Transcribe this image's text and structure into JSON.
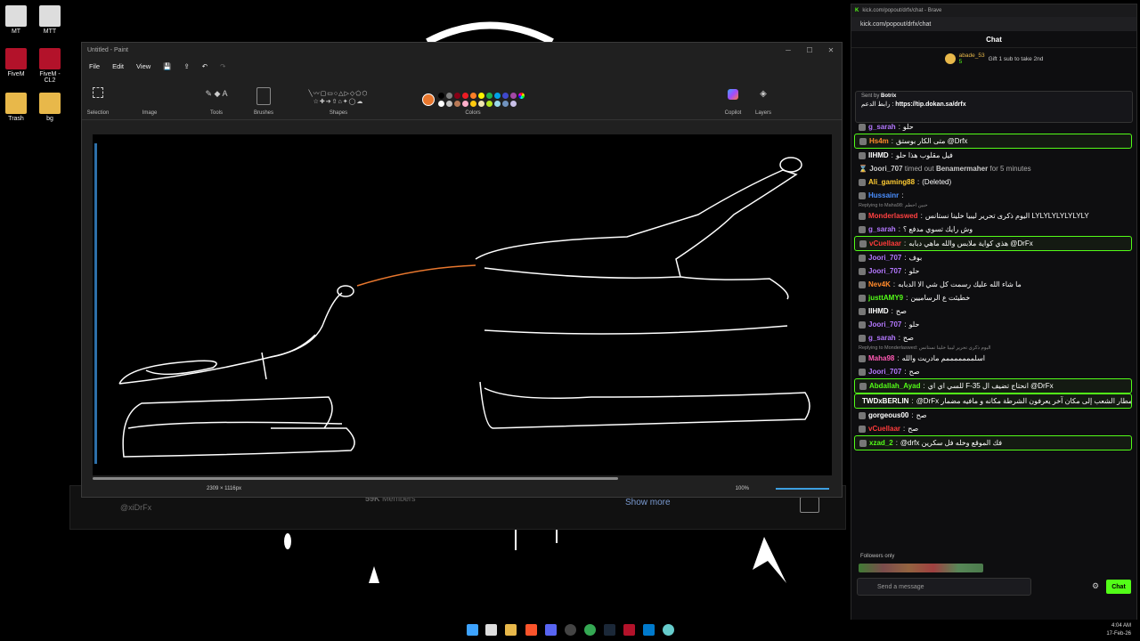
{
  "desktop": {
    "icons": [
      {
        "label": "MT"
      },
      {
        "label": "MTT"
      },
      {
        "label": "FiveM"
      },
      {
        "label": "FiveM - CL2"
      },
      {
        "label": "Trash"
      },
      {
        "label": "bg"
      }
    ]
  },
  "paint": {
    "title": "Untitled - Paint",
    "menu": [
      "File",
      "Edit",
      "View"
    ],
    "groups": [
      "Selection",
      "Image",
      "Tools",
      "Brushes",
      "Shapes",
      "Colors",
      "Copilot",
      "Layers"
    ],
    "status": {
      "canvas_size": "2309 × 1116px",
      "zoom": "100%"
    }
  },
  "behind": {
    "handle": "@xiDrFx",
    "members": "59K",
    "members_label": "Members",
    "show_more": "Show more"
  },
  "browser": {
    "title": "kick.com/popout/drfx/chat - Brave",
    "url": "kick.com/popout/drfx/chat",
    "chat_header": "Chat",
    "gift": {
      "user": "abade_53",
      "count": "5",
      "text": "Gift 1 sub to take 2nd"
    },
    "pinned": {
      "sent_by_label": "Sent by",
      "bot": "Botrix",
      "text": "رابط الدعم :",
      "link": "https://tip.dokan.sa/drfx"
    },
    "messages": [
      {
        "user": "g_sarah",
        "color": "#b478ff",
        "text": "حلو",
        "hl": false
      },
      {
        "user": "Hs4m",
        "color": "#ff8a2b",
        "text": "متى الكار بوستق @Drfx",
        "hl": true
      },
      {
        "user": "IIHMD",
        "color": "#ffffff",
        "text": "فيل مقلوب هذا حلو",
        "hl": false
      },
      {
        "system": true,
        "user": "Joori_707",
        "text": "timed out",
        "target": "Benamermaher",
        "tail": "for 5 minutes"
      },
      {
        "user": "Ali_gaming88",
        "color": "#ffcc33",
        "text": "(Deleted)",
        "hl": false
      },
      {
        "user": "Hussainr",
        "color": "#4a8fff",
        "text": "",
        "hl": false
      },
      {
        "reply": "Replying to Maha98: حبين احطم"
      },
      {
        "user": "Monderlaswed",
        "color": "#ff4040",
        "text": "اليوم ذكرى تحرير ليبيا خلينا نستانس LYLYLYLYLYLYLY",
        "hl": false
      },
      {
        "user": "g_sarah",
        "color": "#b478ff",
        "text": "وش رايك تسوي مدفع ؟",
        "hl": false
      },
      {
        "user": "vCuellaar",
        "color": "#ff3b3b",
        "text": "هذي كواية ملابس والله ماهي دبابه @DrFx",
        "hl": true
      },
      {
        "user": "Joori_707",
        "color": "#b478ff",
        "text": "بوف",
        "hl": false
      },
      {
        "user": "Joori_707",
        "color": "#b478ff",
        "text": "حلو",
        "hl": false
      },
      {
        "user": "Nev4K",
        "color": "#ff8a2b",
        "text": "ما شاء الله عليك رسمت كل شي الا الدبابه",
        "hl": false
      },
      {
        "user": "justtAMY9",
        "color": "#53fc18",
        "text": "خطيئت ع الرساميين",
        "hl": false
      },
      {
        "user": "IIHMD",
        "color": "#ffffff",
        "text": "صح",
        "hl": false
      },
      {
        "user": "Joori_707",
        "color": "#b478ff",
        "text": "حلو",
        "hl": false
      },
      {
        "user": "g_sarah",
        "color": "#b478ff",
        "text": "صح",
        "hl": false
      },
      {
        "reply": "Replying to Monderlaswed: اليوم ذكرى تحرير ليبيا خلينا نستانس"
      },
      {
        "user": "Maha98",
        "color": "#ff5ab4",
        "text": "اسلمممممممم مادريت والله",
        "hl": false
      },
      {
        "user": "Joori_707",
        "color": "#b478ff",
        "text": "صح",
        "hl": false
      },
      {
        "user": "Abdallah_Ayad",
        "color": "#53fc18",
        "text": "للسي اي اي F-35 انحتاج تضيف ال @DrFx",
        "hl": true
      },
      {
        "user": "TWDxBERLIN",
        "color": "#ffffff",
        "text": "@DrFx ممكن اسألك ليش تبدل مطار الشعب إلى مكان آخر يعرفون الشرطة مكانه و مافيه مضمار",
        "hl": true
      },
      {
        "user": "gorgeous00",
        "color": "#ffffff",
        "text": "صح",
        "hl": false
      },
      {
        "user": "vCuellaar",
        "color": "#ff3b3b",
        "text": "صح",
        "hl": false
      },
      {
        "user": "xzad_2",
        "color": "#53fc18",
        "text": "@drfx فك الموقع وخله فل سكرين",
        "hl": true
      }
    ],
    "followers_only": "Followers only",
    "input_placeholder": "Send a message",
    "chat_button": "Chat"
  },
  "taskbar": {
    "time": "4:04 AM",
    "date": "17-Feb-26"
  }
}
